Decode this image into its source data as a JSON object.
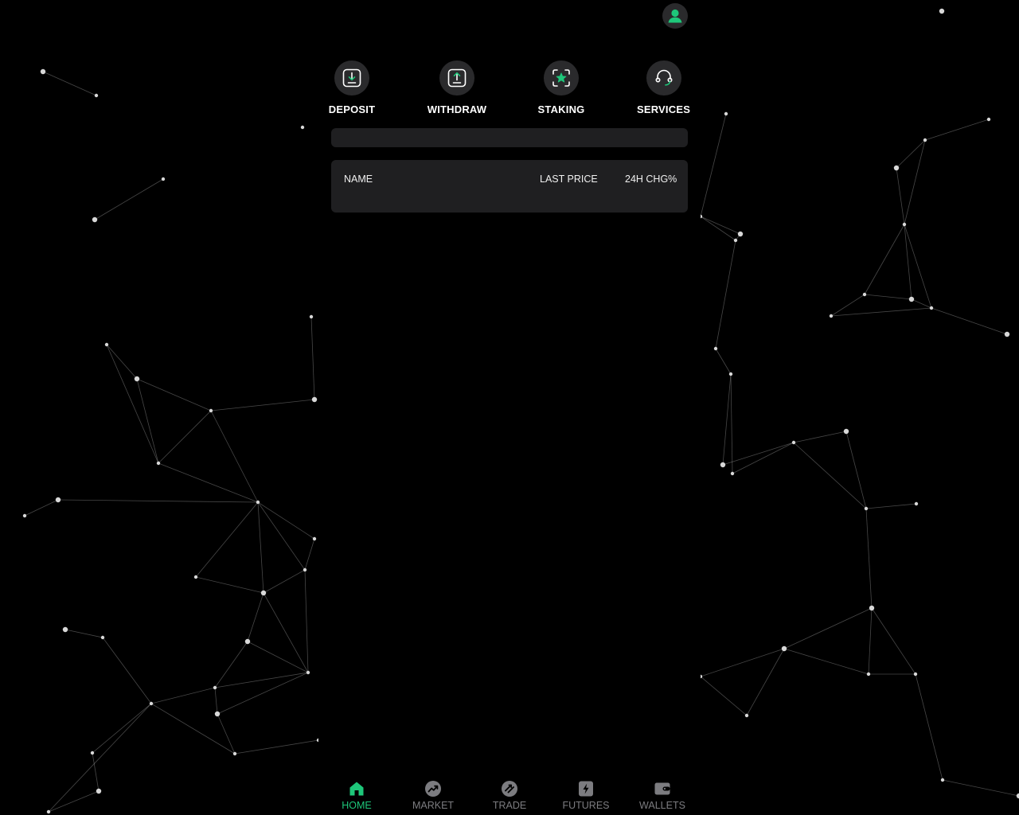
{
  "colors": {
    "accent": "#1ec77a",
    "inactive": "#7c7c80",
    "card": "#1f1f21",
    "icon_bg": "#2a2a2c"
  },
  "header": {
    "avatar_icon": "user-avatar-icon"
  },
  "quick_actions": [
    {
      "label": "DEPOSIT",
      "icon": "deposit-icon"
    },
    {
      "label": "WITHDRAW",
      "icon": "withdraw-icon"
    },
    {
      "label": "STAKING",
      "icon": "staking-icon"
    },
    {
      "label": "SERVICES",
      "icon": "headset-icon"
    }
  ],
  "market_table": {
    "columns": [
      "NAME",
      "LAST PRICE",
      "24H CHG%"
    ],
    "rows": []
  },
  "tabbar": {
    "active": "HOME",
    "tabs": [
      {
        "label": "HOME",
        "icon": "home-icon"
      },
      {
        "label": "MARKET",
        "icon": "market-icon"
      },
      {
        "label": "TRADE",
        "icon": "trade-icon"
      },
      {
        "label": "FUTURES",
        "icon": "futures-icon"
      },
      {
        "label": "WALLETS",
        "icon": "wallet-icon"
      }
    ]
  }
}
